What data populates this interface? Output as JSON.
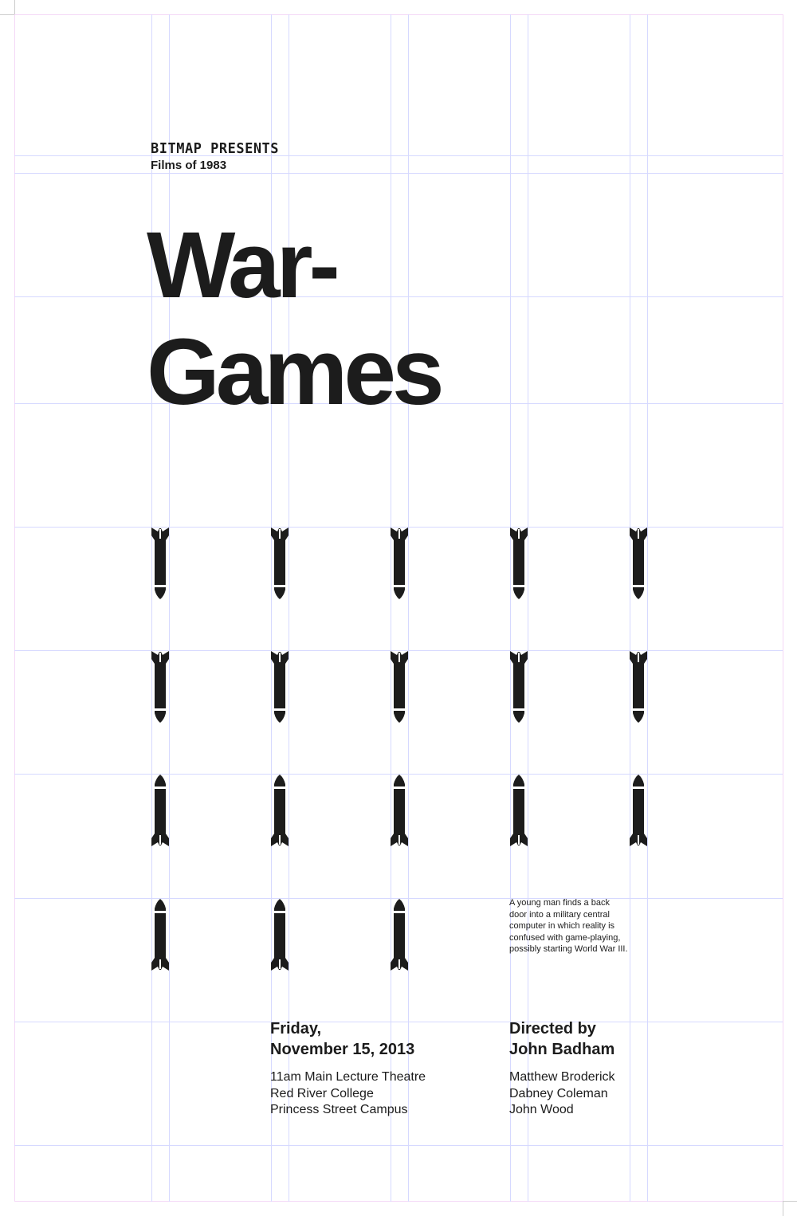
{
  "header": {
    "presenter": "BITMAP PRESENTS",
    "series": "Films of 1983"
  },
  "title": {
    "line1": "War-",
    "line2": "Games"
  },
  "bombs": {
    "rows": [
      {
        "count": 5,
        "direction": "down"
      },
      {
        "count": 5,
        "direction": "down"
      },
      {
        "count": 5,
        "direction": "up"
      },
      {
        "count": 3,
        "direction": "up"
      }
    ],
    "color": "#1c1c1c"
  },
  "synopsis": "A young man finds a back door into a military central computer in which reality is confused with game-playing, possibly starting World War III.",
  "event": {
    "day": "Friday,",
    "date": "November 15, 2013",
    "lines": [
      "11am Main Lecture Theatre",
      "Red River College",
      "Princess Street Campus"
    ]
  },
  "credits": {
    "directed_label": "Directed by",
    "director": "John Badham",
    "cast": [
      "Matthew Broderick",
      "Dabney Coleman",
      "John Wood"
    ]
  },
  "colors": {
    "grid": "#d6d9ff",
    "margin": "#f4d8f6",
    "ink": "#1c1c1c"
  }
}
